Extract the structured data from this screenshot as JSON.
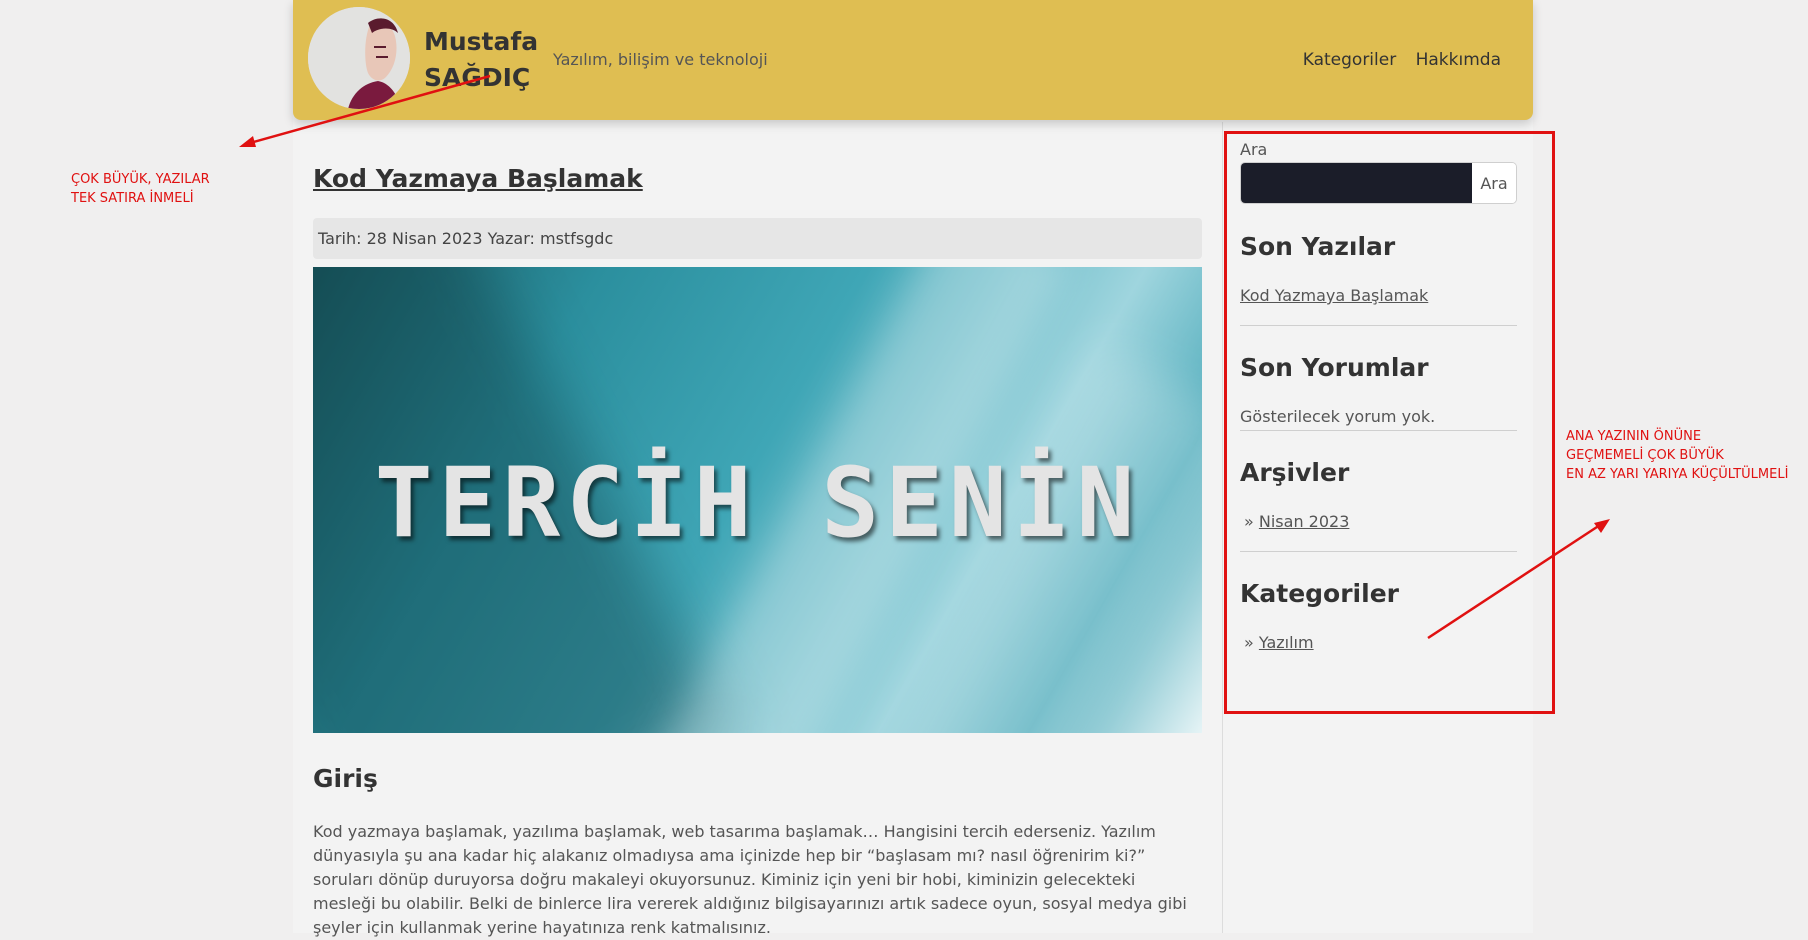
{
  "header": {
    "brand_line1": "Mustafa",
    "brand_line2": "SAĞDIÇ",
    "tagline": "Yazılım, bilişim ve teknoloji",
    "nav": [
      "Kategoriler",
      "Hakkımda"
    ],
    "accent_color": "#dfbe52"
  },
  "article": {
    "title": "Kod Yazmaya Başlamak",
    "meta": {
      "date_label": "Tarih:",
      "date": "28 Nisan 2023",
      "author_label": "Yazar:",
      "author": "mstfsgdc"
    },
    "hero_text": "TERCİH SENİN",
    "section_heading": "Giriş",
    "body": "Kod yazmaya başlamak, yazılıma başlamak, web tasarıma başlamak… Hangisini tercih ederseniz. Yazılım dünyasıyla şu ana kadar hiç alakanız olmadıysa ama içinizde hep bir “başlasam mı? nasıl öğrenirim ki?” soruları dönüp duruyorsa doğru makaleyi okuyorsunuz. Kiminiz için yeni bir hobi, kiminizin gelecekteki mesleği bu olabilir. Belki de binlerce lira vererek aldığınız bilgisayarınızı artık sadece oyun, sosyal medya gibi şeyler için kullanmak yerine hayatınıza renk katmalısınız."
  },
  "sidebar": {
    "search": {
      "label": "Ara",
      "button": "Ara",
      "value": ""
    },
    "recent_posts": {
      "title": "Son Yazılar",
      "items": [
        "Kod Yazmaya Başlamak"
      ]
    },
    "recent_comments": {
      "title": "Son Yorumlar",
      "empty_text": "Gösterilecek yorum yok."
    },
    "archives": {
      "title": "Arşivler",
      "items": [
        "Nisan 2023"
      ]
    },
    "categories": {
      "title": "Kategoriler",
      "items": [
        "Yazılım"
      ]
    }
  },
  "annotations": {
    "left_note": [
      "ÇOK BÜYÜK, YAZILAR",
      "TEK SATIRA İNMELİ"
    ],
    "right_note": [
      "ANA YAZININ ÖNÜNE",
      "GEÇMEMELİ ÇOK BÜYÜK",
      "EN AZ YARI YARIYA KÜÇÜLTÜLMELİ"
    ],
    "annotation_color": "#e01111"
  }
}
